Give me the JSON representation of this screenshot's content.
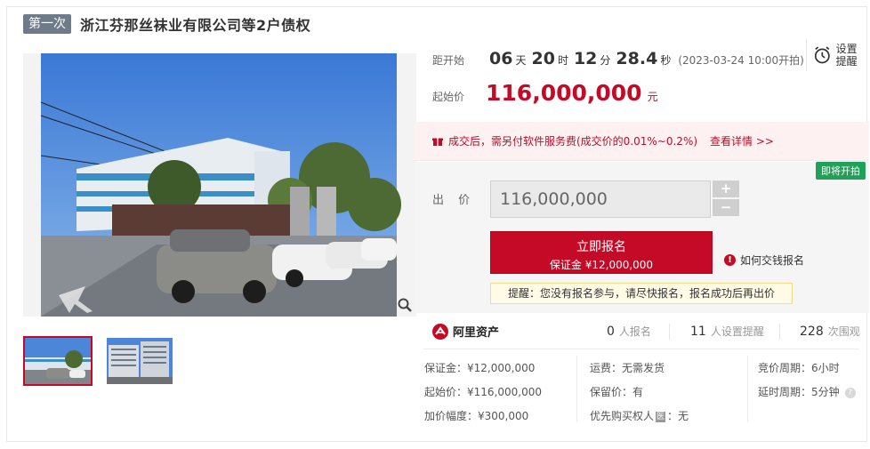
{
  "title": {
    "round_tag": "第一次",
    "text": "浙江芬那丝袜业有限公司等2户债权"
  },
  "countdown": {
    "label": "距开始",
    "days": "06",
    "days_unit": "天",
    "hours": "20",
    "hours_unit": "时",
    "minutes": "12",
    "minutes_unit": "分",
    "seconds": "28.4",
    "seconds_unit": "秒",
    "start_date": "(2023-03-24 10:00开拍)"
  },
  "alarm": {
    "icon": "alarm-clock-icon",
    "label": "设置提醒"
  },
  "starting_price": {
    "label": "起始价",
    "value": "116,000,000",
    "unit": "元"
  },
  "fee_notice": {
    "icon": "gift-icon",
    "text": "成交后，需另付软件服务费(成交价的0.01%~0.2%)",
    "link": "查看详情 >>"
  },
  "bid": {
    "badge": "即将开拍",
    "label": "出 价",
    "value": "116,000,000",
    "plus": "+",
    "minus": "−",
    "signup_main": "立即报名",
    "signup_sub": "保证金 ¥12,000,000",
    "howto": "如何交钱报名",
    "howto_icon": "!",
    "reminder": "提醒：您没有报名参与，请尽快报名，报名成功后再出价"
  },
  "stats": {
    "brand": "阿里资产",
    "signups": "0",
    "signups_label": "人报名",
    "reminders": "11",
    "reminders_label": "人设置提醒",
    "views": "228",
    "views_label": "次围观"
  },
  "details": {
    "deposit": "保证金：¥12,000,000",
    "start_price": "起始价：¥116,000,000",
    "increment": "加价幅度：¥300,000",
    "shipping": "运费：无需发货",
    "reserve": "保留价：有",
    "priority_label": "优先购买权人",
    "priority_tag": "医",
    "priority_value": "：无",
    "bid_cycle": "竞价周期：6小时",
    "extension": "延时周期：5分钟",
    "help": "?"
  },
  "colors": {
    "accent": "#c40a26",
    "badge_green": "#20a058",
    "tag_gray": "#6f7b8a"
  }
}
